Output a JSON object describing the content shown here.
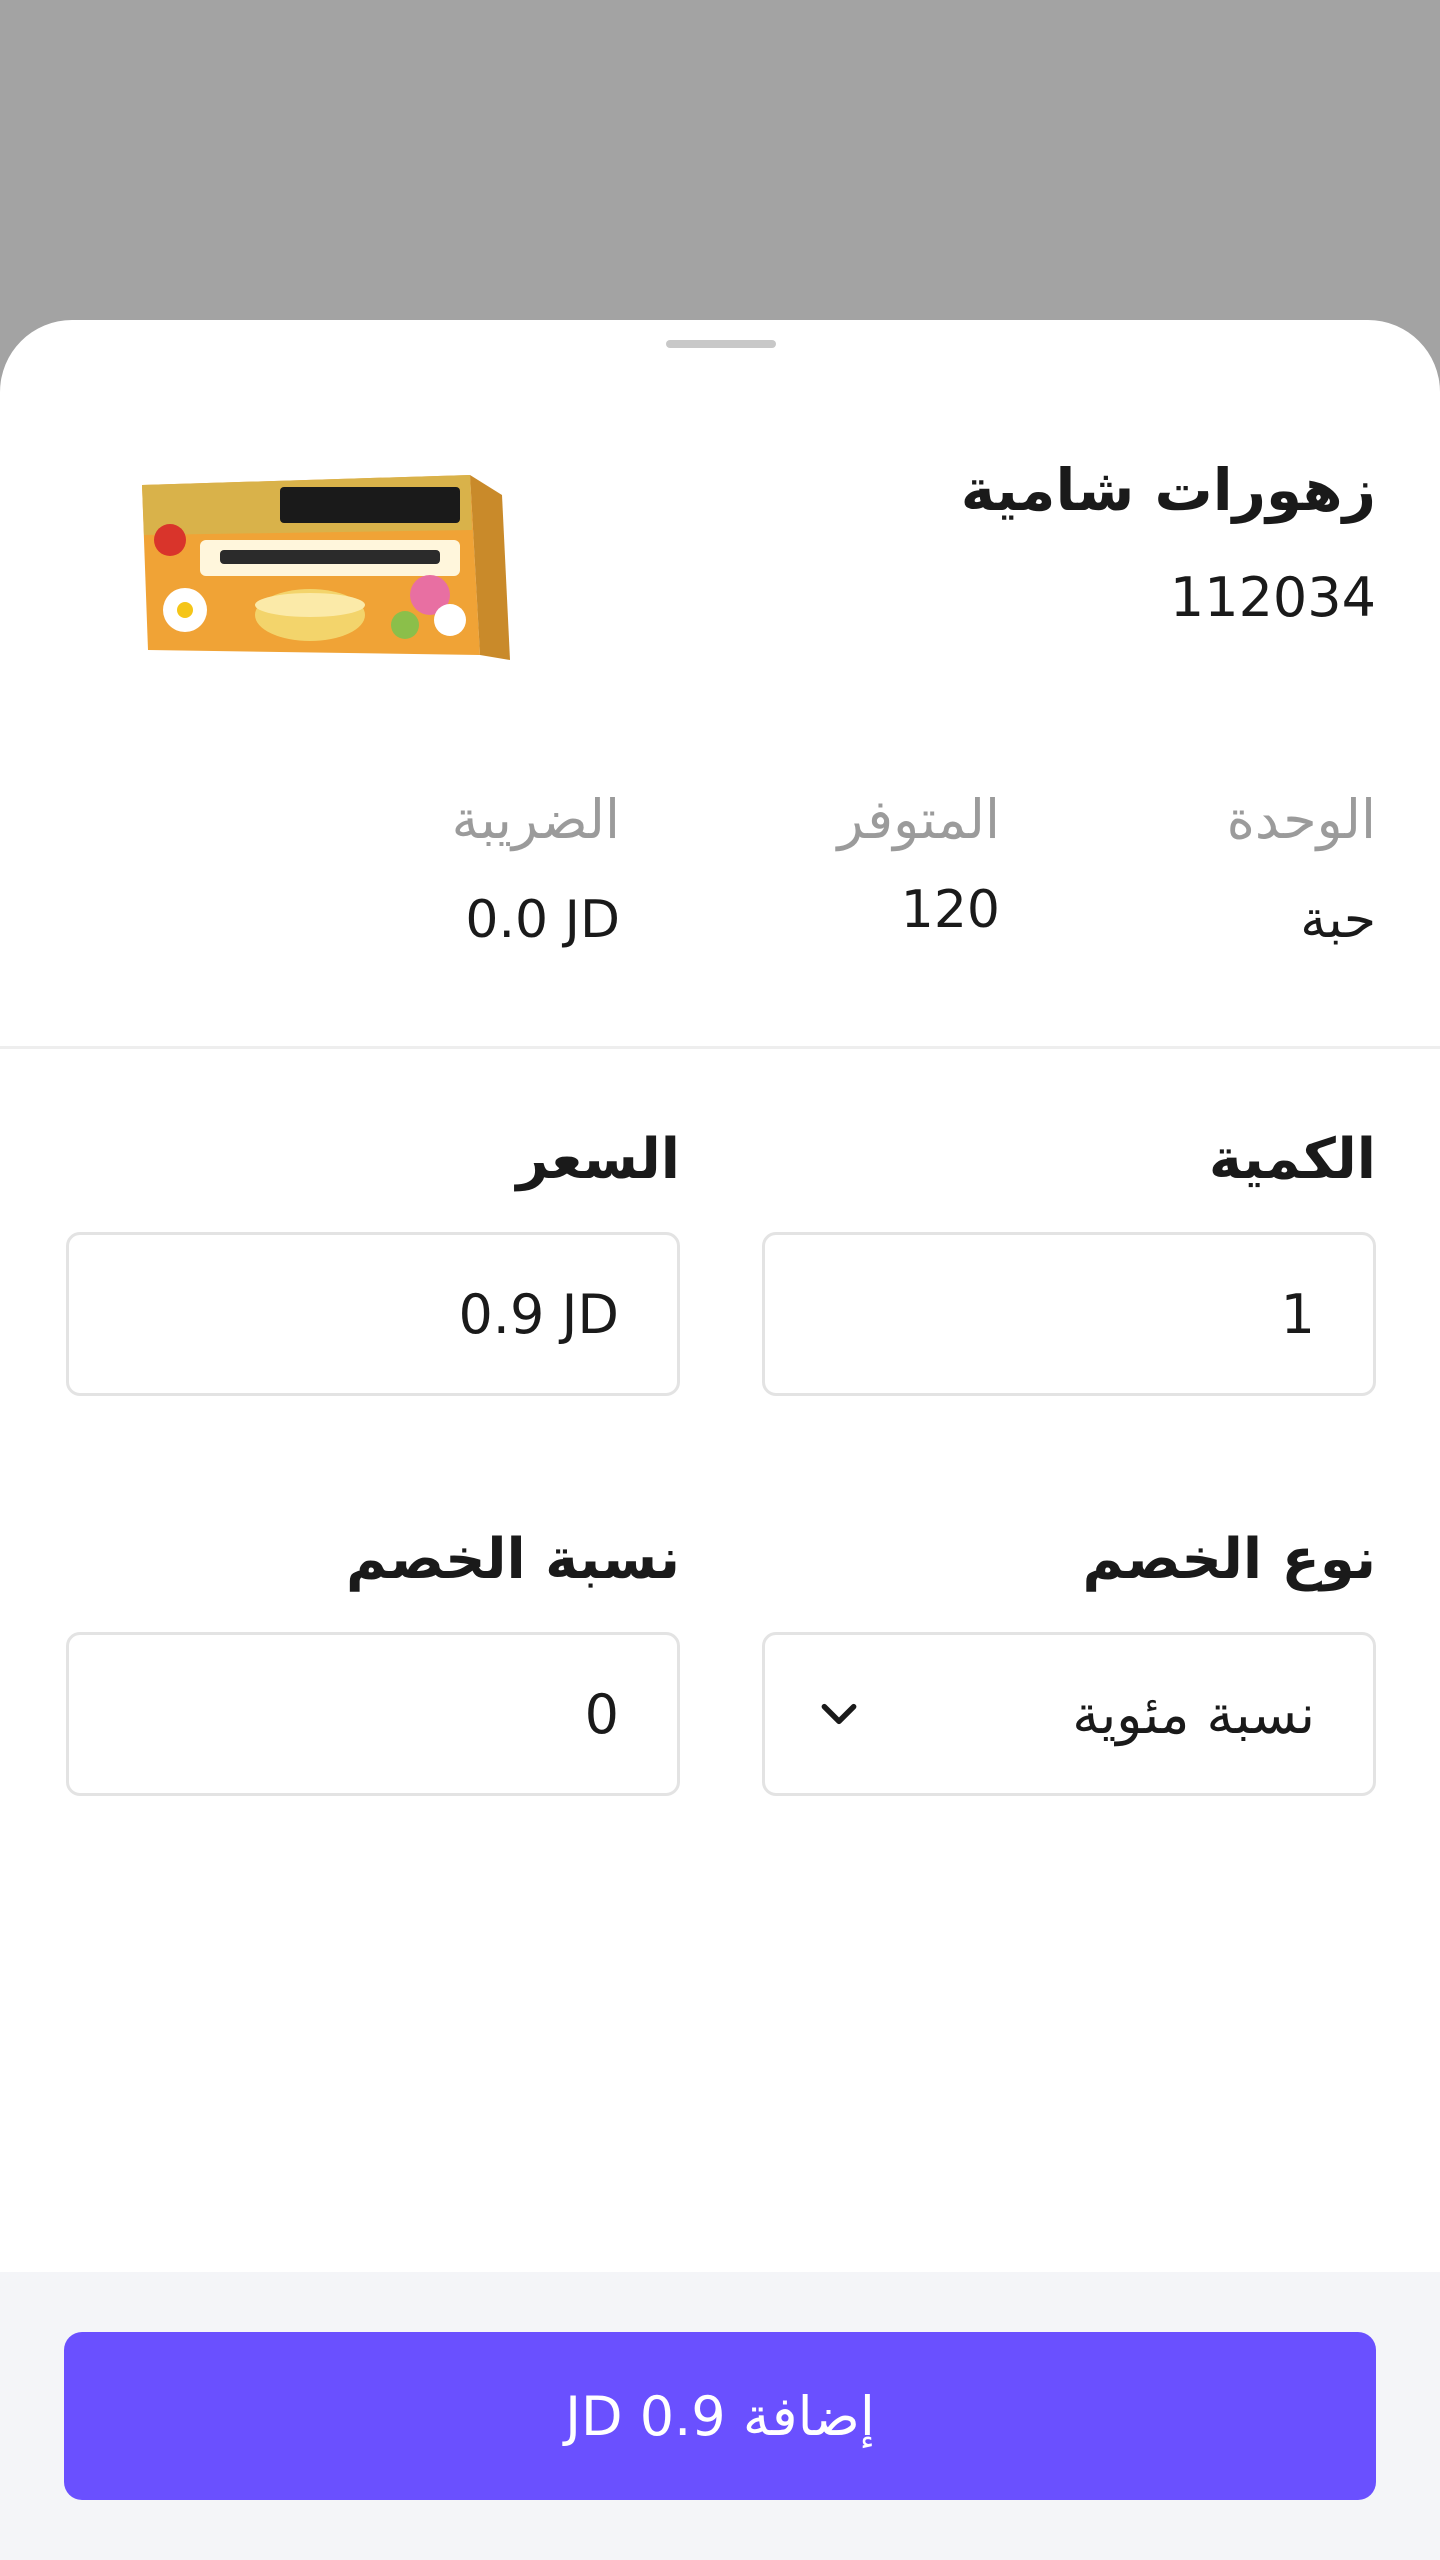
{
  "product": {
    "name": "زهورات شامية",
    "code": "112034",
    "image_icon": "product-image"
  },
  "info": {
    "unit": {
      "label": "الوحدة",
      "value": "حبة"
    },
    "available": {
      "label": "المتوفر",
      "value": "120"
    },
    "tax": {
      "label": "الضريبة",
      "value": "0.0 JD"
    }
  },
  "form": {
    "quantity": {
      "label": "الكمية",
      "value": "1"
    },
    "price": {
      "label": "السعر",
      "value": "0.9 JD"
    },
    "discount_type": {
      "label": "نوع الخصم",
      "value": "نسبة مئوية"
    },
    "discount_percent": {
      "label": "نسبة الخصم",
      "value": "0"
    }
  },
  "footer": {
    "add_button_label": "إضافة 0.9 JD"
  },
  "colors": {
    "accent": "#6a50ff",
    "overlay": "#a3a3a3"
  }
}
